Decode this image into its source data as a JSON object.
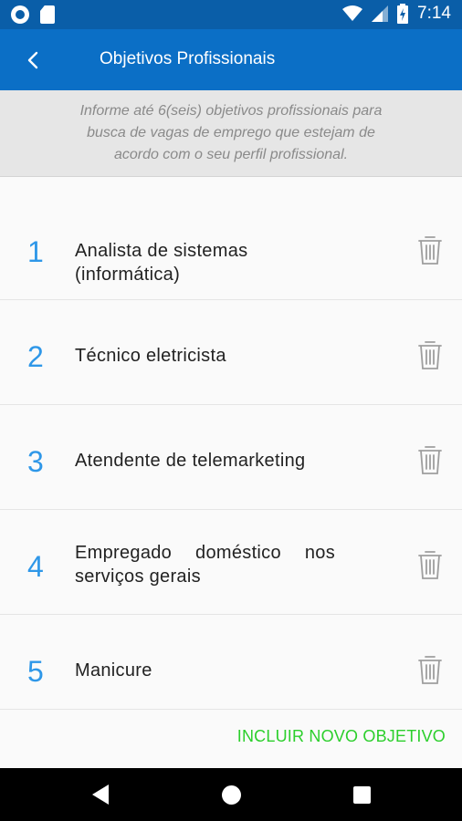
{
  "status_bar": {
    "time": "7:14",
    "icons": [
      "circle-notification-icon",
      "sd-card-icon",
      "wifi-icon",
      "signal-icon",
      "battery-charging-icon"
    ]
  },
  "app_bar": {
    "title": "Objetivos Profissionais",
    "back_icon": "chevron-left-icon"
  },
  "info": {
    "text": "Informe até 6(seis) objetivos profissionais para busca de vagas de emprego que estejam de acordo com o seu perfil profissional."
  },
  "objectives": [
    {
      "number": "1",
      "title": "Analista de sistemas (informática)"
    },
    {
      "number": "2",
      "title": "Técnico eletricista"
    },
    {
      "number": "3",
      "title": "Atendente de telemarketing"
    },
    {
      "number": "4",
      "title": "Empregado doméstico nos serviços gerais"
    },
    {
      "number": "5",
      "title": "Manicure"
    }
  ],
  "actions": {
    "add_label": "INCLUIR NOVO OBJETIVO"
  },
  "colors": {
    "status_bar": "#0a5ea8",
    "app_bar": "#0b6fc6",
    "number": "#2e97e8",
    "add_button": "#2ccf2c"
  }
}
